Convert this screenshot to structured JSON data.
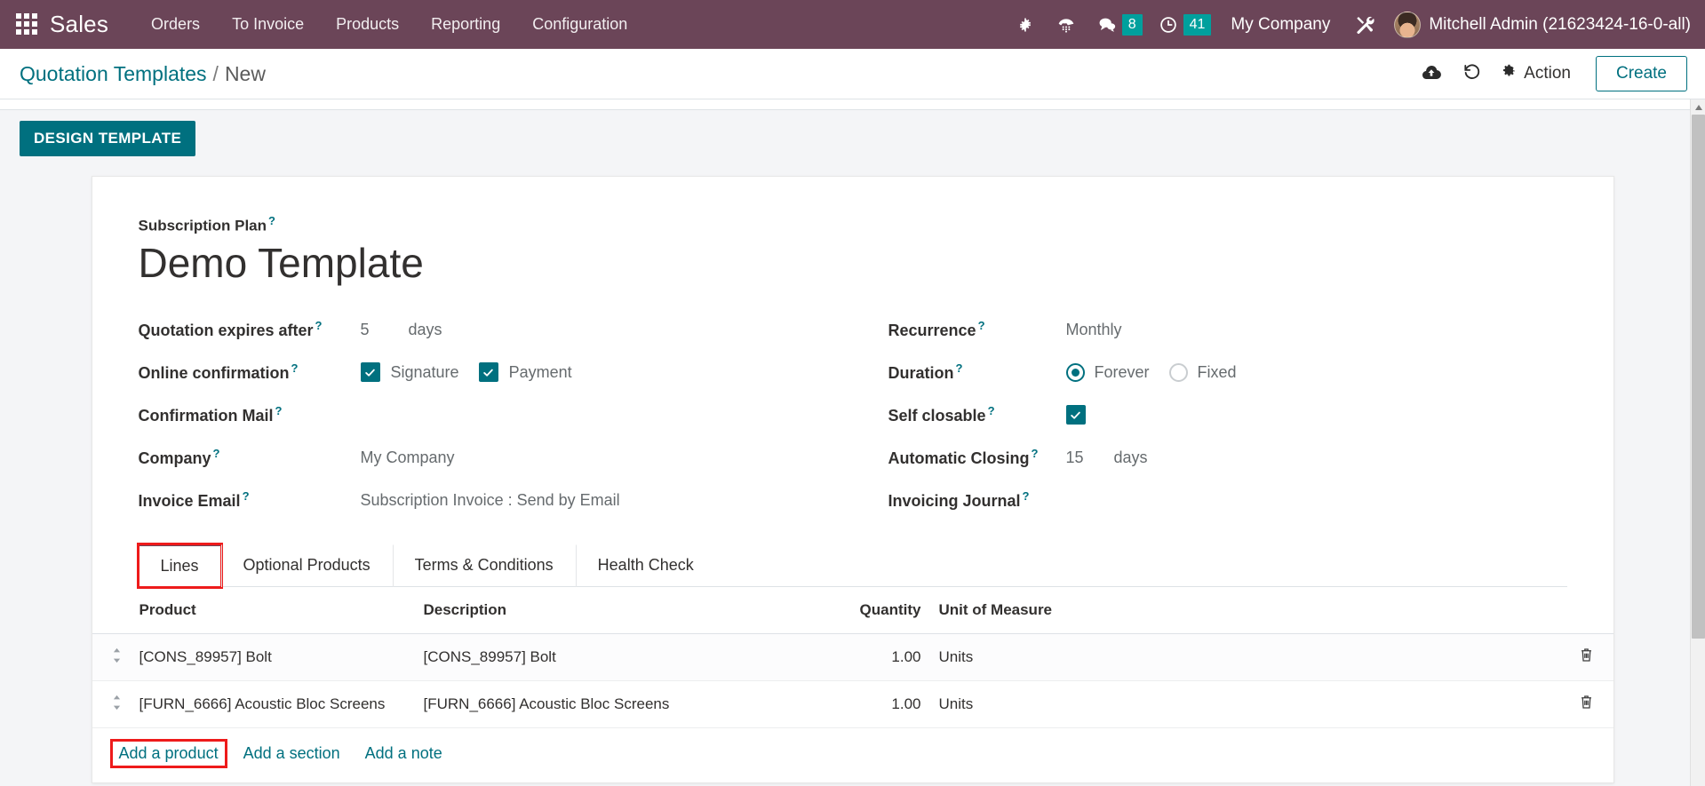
{
  "navbar": {
    "apps_icon": "apps-grid-icon",
    "brand": "Sales",
    "menu": [
      {
        "label": "Orders"
      },
      {
        "label": "To Invoice"
      },
      {
        "label": "Products"
      },
      {
        "label": "Reporting"
      },
      {
        "label": "Configuration"
      }
    ],
    "icons": {
      "bug": "bug-icon",
      "phone": "dialpad-phone-icon",
      "messages": "chat-bubble-icon",
      "activities": "clock-icon",
      "tools": "tools-icon"
    },
    "messages_count": "8",
    "activities_count": "41",
    "company": "My Company",
    "user": "Mitchell Admin (21623424-16-0-all)",
    "accent_badge_color": "#00a09d",
    "background_color": "#6b4558"
  },
  "control_bar": {
    "breadcrumb_root": "Quotation Templates",
    "breadcrumb_sep": "/",
    "breadcrumb_current": "New",
    "save_icon": "cloud-upload-icon",
    "discard_icon": "undo-icon",
    "action_label": "Action",
    "action_icon": "gear-icon",
    "create_label": "Create",
    "accent_color": "#00707f"
  },
  "statusbar": {
    "design_template_label": "DESIGN TEMPLATE",
    "color": "#00707f"
  },
  "form": {
    "plan_label": "Subscription Plan",
    "title": "Demo Template",
    "left_fields": [
      {
        "label": "Quotation expires after",
        "type": "number_unit",
        "value": "5",
        "unit": "days"
      },
      {
        "label": "Online confirmation",
        "type": "checkbox_group",
        "options": [
          {
            "label": "Signature",
            "checked": true
          },
          {
            "label": "Payment",
            "checked": true
          }
        ]
      },
      {
        "label": "Confirmation Mail",
        "type": "text",
        "value": ""
      },
      {
        "label": "Company",
        "type": "text",
        "value": "My Company"
      },
      {
        "label": "Invoice Email",
        "type": "text",
        "value": "Subscription Invoice : Send by Email"
      }
    ],
    "right_fields": [
      {
        "label": "Recurrence",
        "type": "text",
        "value": "Monthly"
      },
      {
        "label": "Duration",
        "type": "radio_group",
        "options": [
          {
            "label": "Forever",
            "selected": true
          },
          {
            "label": "Fixed",
            "selected": false
          }
        ]
      },
      {
        "label": "Self closable",
        "type": "checkbox",
        "checked": true
      },
      {
        "label": "Automatic Closing",
        "type": "number_unit",
        "value": "15",
        "unit": "days"
      },
      {
        "label": "Invoicing Journal",
        "type": "text",
        "value": ""
      }
    ],
    "help_marker": "?"
  },
  "notebook": {
    "tabs": [
      {
        "label": "Lines",
        "active": true,
        "highlighted": true
      },
      {
        "label": "Optional Products",
        "active": false,
        "highlighted": false
      },
      {
        "label": "Terms & Conditions",
        "active": false,
        "highlighted": false
      },
      {
        "label": "Health Check",
        "active": false,
        "highlighted": false
      }
    ]
  },
  "lines": {
    "columns": [
      "Product",
      "Description",
      "Quantity",
      "Unit of Measure"
    ],
    "rows": [
      {
        "product": "[CONS_89957] Bolt",
        "description": "[CONS_89957] Bolt",
        "quantity": "1.00",
        "uom": "Units",
        "drag_icon": "drag-handle-icon",
        "delete_icon": "trash-icon"
      },
      {
        "product": "[FURN_6666] Acoustic Bloc Screens",
        "description": "[FURN_6666] Acoustic Bloc Screens",
        "quantity": "1.00",
        "uom": "Units",
        "drag_icon": "drag-handle-icon",
        "delete_icon": "trash-icon"
      }
    ],
    "add_product": "Add a product",
    "add_section": "Add a section",
    "add_note": "Add a note",
    "add_product_highlighted": true,
    "highlight_color": "#ee1b1b"
  },
  "scrollbar": {
    "arrow_up_icon": "caret-up-icon"
  }
}
